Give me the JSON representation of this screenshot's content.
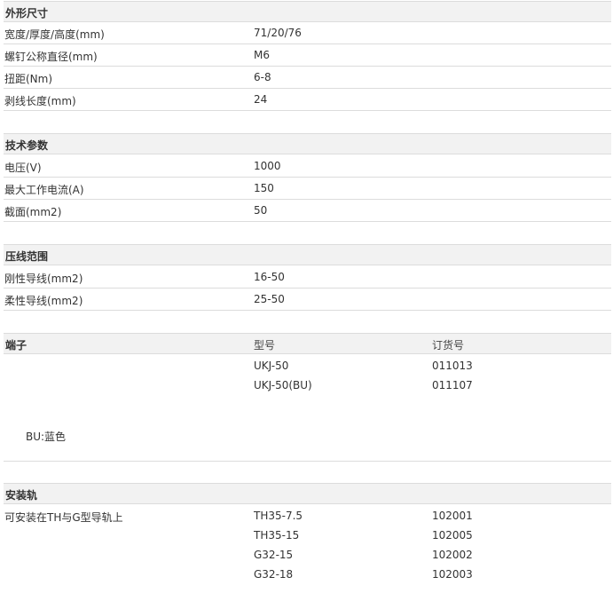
{
  "dimensions": {
    "title": "外形尺寸",
    "rows": [
      {
        "label": "宽度/厚度/高度(mm)",
        "value": "71/20/76"
      },
      {
        "label": "螺钉公称直径(mm)",
        "value": "M6"
      },
      {
        "label": "扭距(Nm)",
        "value": "6-8"
      },
      {
        "label": "剥线长度(mm)",
        "value": "24"
      }
    ]
  },
  "technical": {
    "title": "技术参数",
    "rows": [
      {
        "label": "电压(V)",
        "value": "1000"
      },
      {
        "label": "最大工作电流(A)",
        "value": "150"
      },
      {
        "label": "截面(mm2)",
        "value": "50"
      }
    ]
  },
  "crimp": {
    "title": "压线范围",
    "rows": [
      {
        "label": "刚性导线(mm2)",
        "value": "16-50"
      },
      {
        "label": "柔性导线(mm2)",
        "value": "25-50"
      }
    ]
  },
  "terminal": {
    "title": "端子",
    "col_model": "型号",
    "col_order": "订货号",
    "items": [
      {
        "model": "UKJ-50",
        "order": "011013"
      },
      {
        "model": "UKJ-50(BU)",
        "order": "011107"
      }
    ],
    "note": "BU:蓝色"
  },
  "rail": {
    "title": "安装轨",
    "desc": "可安装在TH与G型导轨上",
    "items": [
      {
        "model": "TH35-7.5",
        "order": "102001"
      },
      {
        "model": "TH35-15",
        "order": "102005"
      },
      {
        "model": "G32-15",
        "order": "102002"
      },
      {
        "model": "G32-18",
        "order": "102003"
      }
    ]
  }
}
